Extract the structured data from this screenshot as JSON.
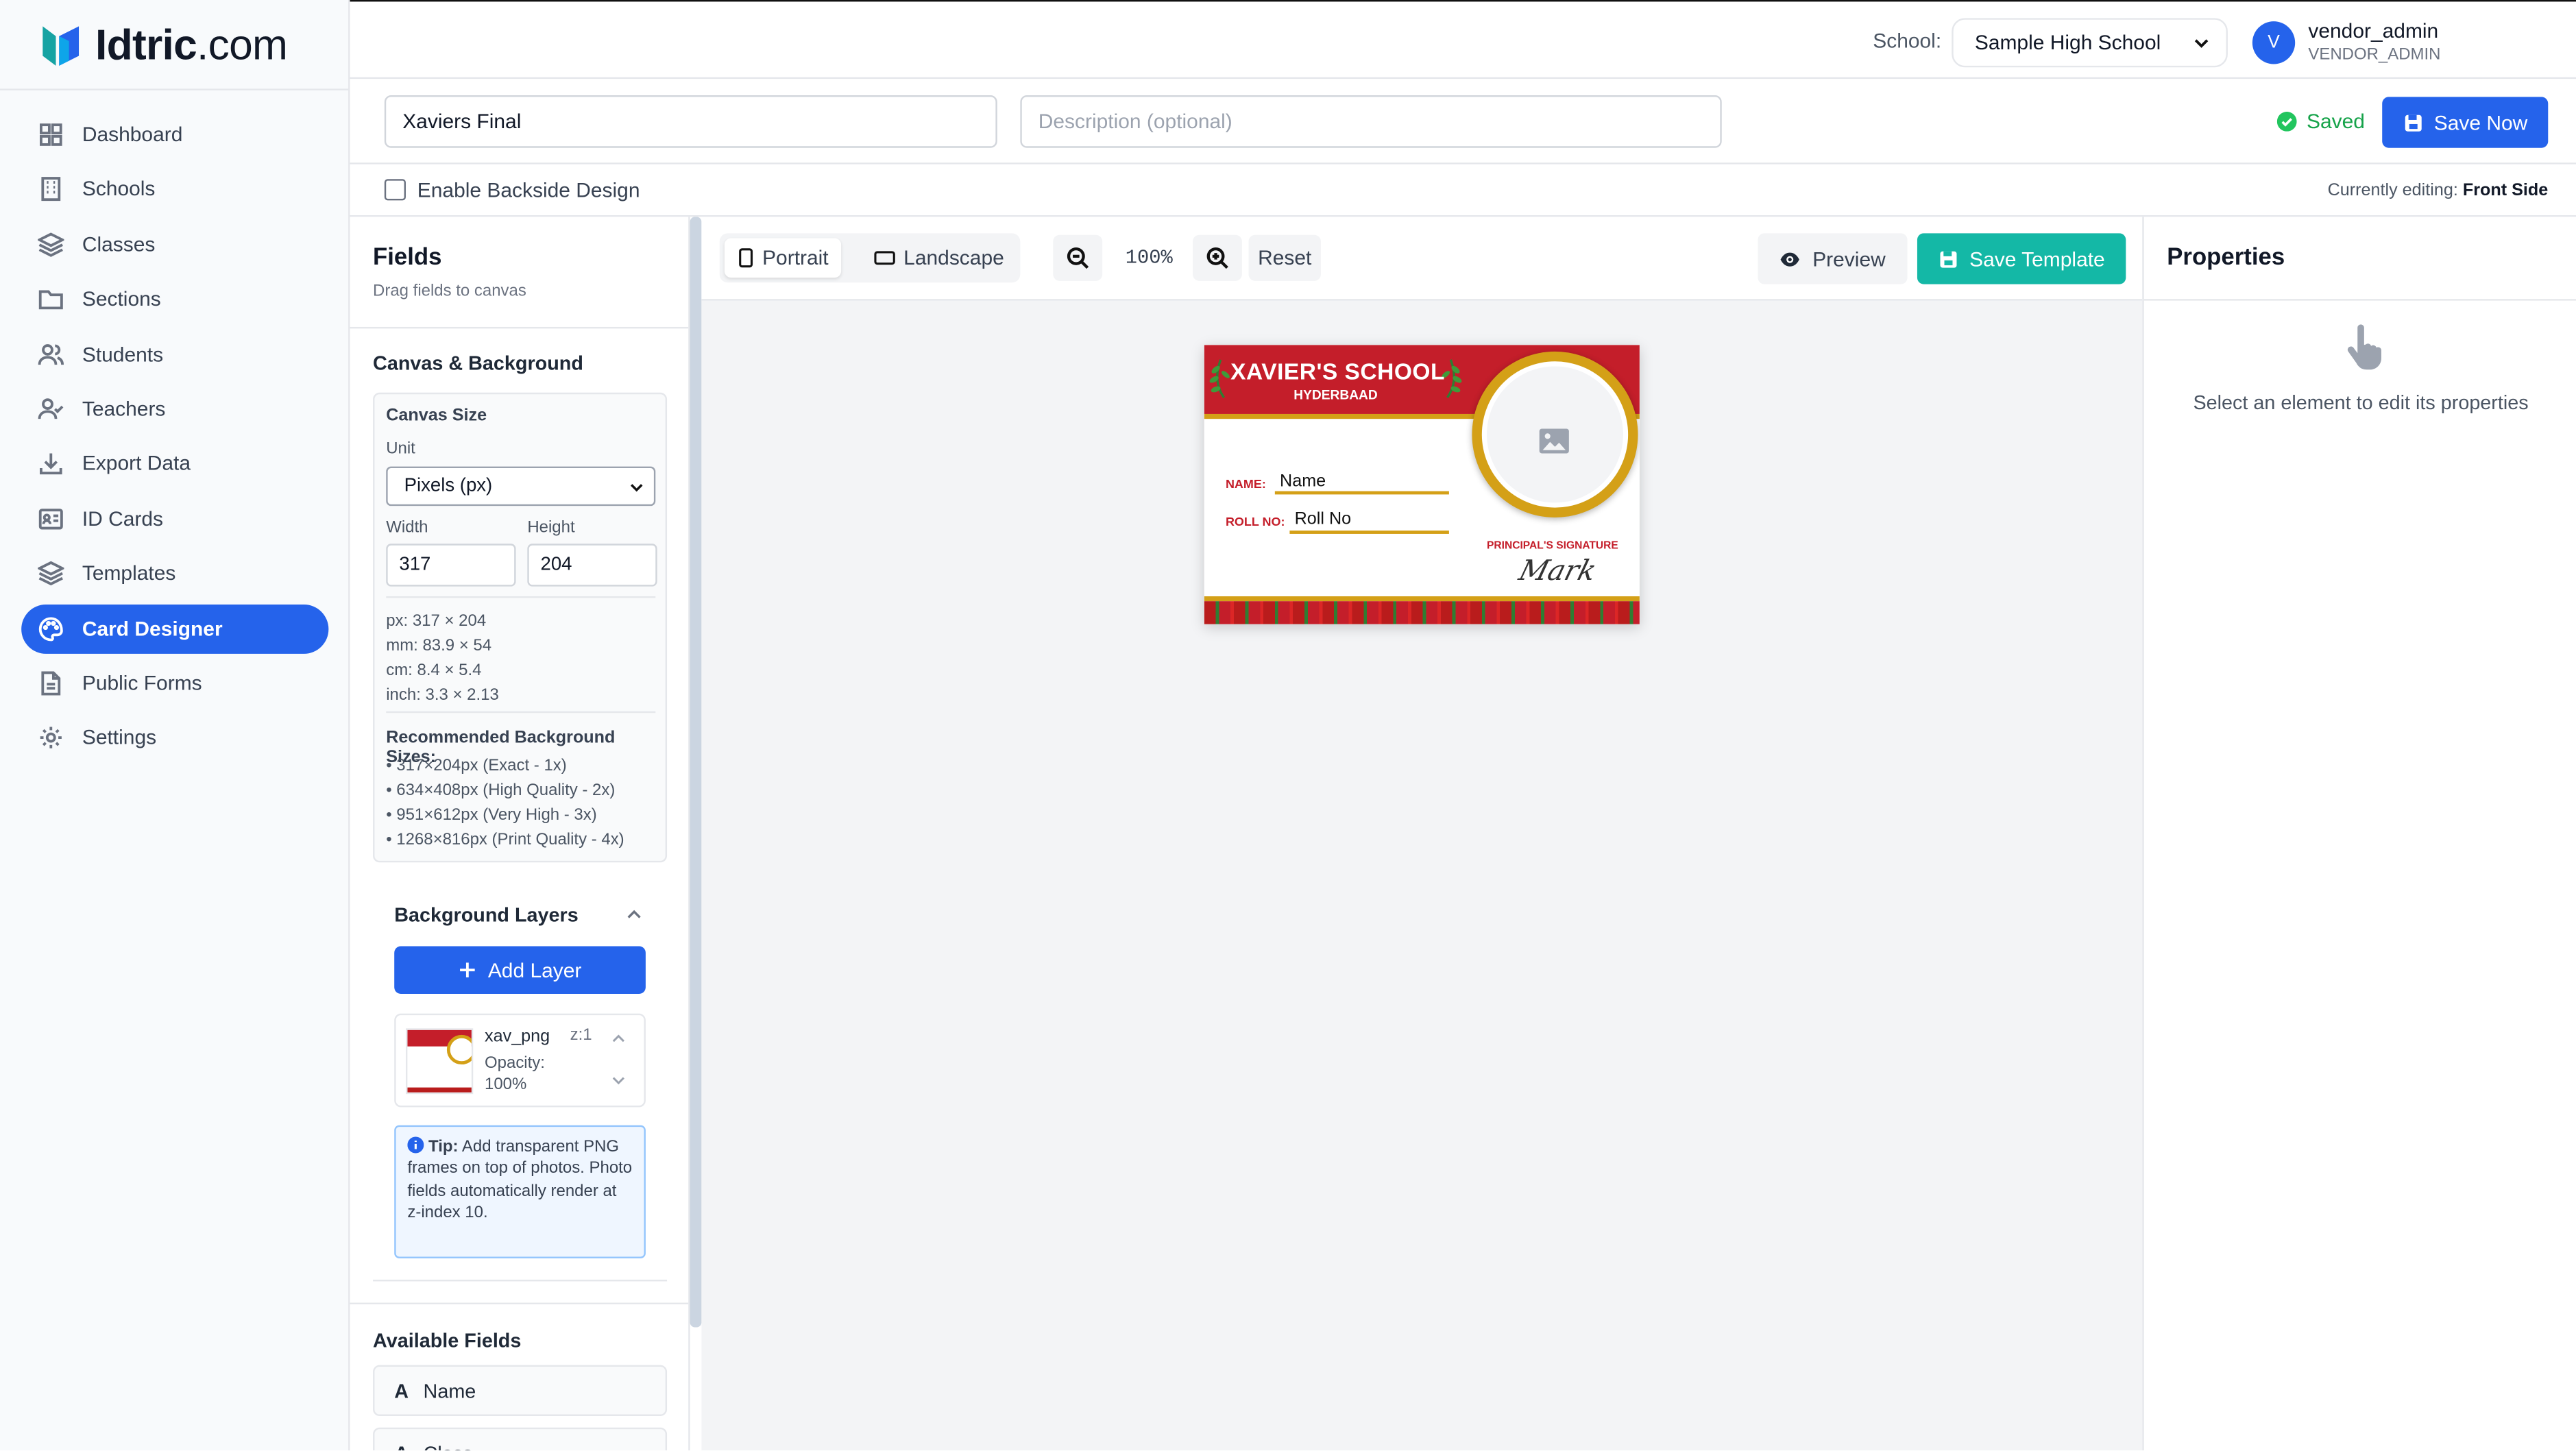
{
  "brand": {
    "name_bold": "Idtric",
    "name_rest": ".com"
  },
  "nav": [
    {
      "label": "Dashboard",
      "icon": "dashboard-icon"
    },
    {
      "label": "Schools",
      "icon": "building-icon"
    },
    {
      "label": "Classes",
      "icon": "layers-icon"
    },
    {
      "label": "Sections",
      "icon": "folder-icon"
    },
    {
      "label": "Students",
      "icon": "users-icon"
    },
    {
      "label": "Teachers",
      "icon": "user-check-icon"
    },
    {
      "label": "Export Data",
      "icon": "download-icon"
    },
    {
      "label": "ID Cards",
      "icon": "id-card-icon"
    },
    {
      "label": "Templates",
      "icon": "layers-icon"
    },
    {
      "label": "Card Designer",
      "icon": "palette-icon",
      "active": true
    },
    {
      "label": "Public Forms",
      "icon": "file-icon"
    },
    {
      "label": "Settings",
      "icon": "gear-icon"
    }
  ],
  "topbar": {
    "school_label": "School:",
    "school_value": "Sample High School",
    "avatar_initial": "V",
    "user_name": "vendor_admin",
    "user_role": "VENDOR_ADMIN"
  },
  "template": {
    "name_value": "Xaviers Final",
    "description_placeholder": "Description (optional)",
    "saved_label": "Saved",
    "save_now_label": "Save Now"
  },
  "backside": {
    "checkbox_label": "Enable Backside Design",
    "editing_prefix": "Currently editing:",
    "editing_value": "Front Side"
  },
  "fields_panel": {
    "title": "Fields",
    "subtitle": "Drag fields to canvas",
    "canvas_bg_title": "Canvas & Background",
    "canvas_size_title": "Canvas Size",
    "unit_label": "Unit",
    "unit_value": "Pixels (px)",
    "width_label": "Width",
    "height_label": "Height",
    "width_value": "317",
    "height_value": "204",
    "dims": [
      "px: 317 × 204",
      "mm: 83.9 × 54",
      "cm: 8.4 × 5.4",
      "inch: 3.3 × 2.13"
    ],
    "rec_title": "Recommended Background Sizes:",
    "rec_sizes": [
      "• 317×204px (Exact - 1x)",
      "• 634×408px (High Quality - 2x)",
      "• 951×612px (Very High - 3x)",
      "• 1268×816px (Print Quality - 4x)"
    ],
    "bg_layers_title": "Background Layers",
    "add_layer_label": "Add Layer",
    "layer": {
      "name": "xav_png",
      "z": "z:1",
      "opacity_label": "Opacity:",
      "opacity_value": "100%"
    },
    "tip_bold": "Tip:",
    "tip_text": "Add transparent PNG frames on top of photos. Photo fields automatically render at z-index 10.",
    "available_title": "Available Fields",
    "available": [
      "Name",
      "Class"
    ]
  },
  "canvas_toolbar": {
    "portrait_label": "Portrait",
    "landscape_label": "Landscape",
    "zoom_value": "100%",
    "reset_label": "Reset",
    "preview_label": "Preview",
    "save_template_label": "Save Template"
  },
  "card": {
    "school_name": "XAVIER'S SCHOOL",
    "city": "HYDERBAAD",
    "name_label": "NAME:",
    "name_value": "Name",
    "roll_label": "ROLL NO:",
    "roll_value": "Roll No",
    "signature_label": "PRINCIPAL'S SIGNATURE",
    "signature_text": "Mark",
    "colors": {
      "header": "#c41e2a",
      "gold": "#d4a017"
    }
  },
  "properties": {
    "title": "Properties",
    "empty_message": "Select an element to edit its properties"
  },
  "colors": {
    "primary": "#2563eb",
    "teal": "#14b8a6",
    "success": "#16a34a"
  }
}
